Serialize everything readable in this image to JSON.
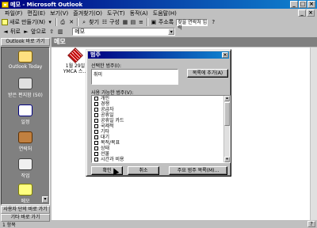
{
  "window": {
    "title": "메모 - Microsoft Outlook",
    "controls": {
      "minimize": "_",
      "maximize": "□",
      "close": "×"
    }
  },
  "menu": {
    "items": [
      "파일(F)",
      "편집(E)",
      "보기(V)",
      "즐겨찾기(O)",
      "도구(T)",
      "동작(A)",
      "도움말(H)"
    ]
  },
  "toolbar1": {
    "new_label": "새로 만들기(N)",
    "find_label": "찾기",
    "organize_label": "구성",
    "address_book_label": "주소록",
    "find_contact_placeholder": "찾을 연락처 입력"
  },
  "toolbar2": {
    "back_label": "뒤로",
    "forward_label": "앞으로",
    "address_value": "메모"
  },
  "outlook_bar": {
    "header": "Outlook 바로 가기",
    "shortcuts": [
      {
        "label": "Outlook Today",
        "icon": "outlook-today-icon"
      },
      {
        "label": "받은 편지함 (50)",
        "icon": "inbox-icon"
      },
      {
        "label": "일정",
        "icon": "calendar-icon"
      },
      {
        "label": "연락처",
        "icon": "contacts-icon"
      },
      {
        "label": "작업",
        "icon": "tasks-icon"
      },
      {
        "label": "메모",
        "icon": "notes-icon"
      }
    ],
    "groups": [
      "사용자 단의 바로 가기",
      "기타 바로 가기"
    ]
  },
  "folder": {
    "name": "메모"
  },
  "note": {
    "label": "1월 29일\nYMCA 스..."
  },
  "dialog": {
    "title": "범주",
    "item_label": "선택한 범주(I):",
    "item_value": "취미",
    "add_button": "목록에 추가(A)",
    "available_label": "사용 가능한 범주(V):",
    "categories": [
      "개인",
      "경쟁",
      "공급자",
      "공휴일",
      "공휴일 카드",
      "국제적",
      "기타",
      "대기",
      "목적/목표",
      "상태",
      "선물",
      "시간과 비용"
    ],
    "ok": "확인",
    "cancel": "취소",
    "master_button": "주요 범주 목록(M)..."
  },
  "status": {
    "text": "1 항목"
  },
  "colors": {
    "title_bar": "#000080",
    "window_bg": "#c0c0c0",
    "outlook_bar_bg": "#808080",
    "note_icon": "#c00000"
  }
}
